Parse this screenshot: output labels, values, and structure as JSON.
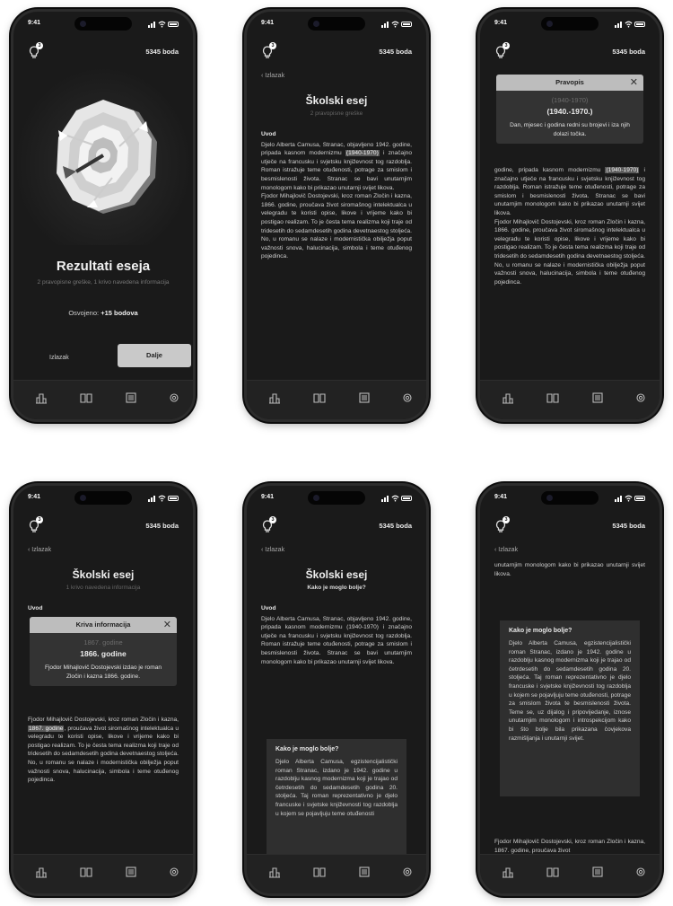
{
  "status": {
    "time": "9:41"
  },
  "header": {
    "points": "5345 boda",
    "hint_count": "3"
  },
  "nav": {
    "back": "Izlazak"
  },
  "tabs": [
    "stats",
    "book",
    "essay",
    "settings"
  ],
  "screen1": {
    "title": "Rezultati eseja",
    "subtitle": "2 pravopisne greške, 1 krivo navedena informacija",
    "earned_label": "Osvojeno:",
    "earned_value": "+15 bodova",
    "exit_label": "Izlazak",
    "next_label": "Dalje"
  },
  "screen2": {
    "title": "Školski esej",
    "subtitle": "2 pravopisne greške",
    "section": "Uvod",
    "p1_a": "Djelo Alberta Camusa, Stranac, objavljeno 1942. godine, pripada kasnom modernizmu ",
    "p1_hl": "(1940-1970)",
    "p1_b": " i značajno utječe na francusku i svjetsku književnost tog razdoblja. Roman istražuje teme otuđenosti, potrage za smislom i besmislenosti života. Stranac se bavi unutarnjim monologom kako bi prikazao unutarnji svijet likova.",
    "p2": "Fjodor Mihajlovič Dostojevski, kroz roman Zločin i kazna, 1866. godine, proučava život siromašnog intelektualca u velegradu te koristi opise, likove i vrijeme kako bi postigao realizam. To je česta tema realizma koji traje od tridesetih do sedamdesetih godina devetnaestog stoljeća. No, u romanu se nalaze i modernistička obilježja poput važnosti snova, halucinacija, simbola i teme otuđenog pojedinca."
  },
  "screen3": {
    "modal_title": "Pravopis",
    "old": "(1940-1970)",
    "new": "(1940.-1970.)",
    "note": "Dan, mjesec i godina redni su brojevi i iza njih dolazi točka.",
    "p1_a": "godine, pripada kasnom modernizmu ",
    "p1_hl": "(1940-1970)",
    "p1_b": " i značajno utječe na francusku i svjetsku književnost tog razdoblja. Roman istražuje teme otuđenosti, potrage za smislom i besmislenosti života. Stranac se bavi unutarnjim monologom kako bi prikazao unutarnji svijet likova.",
    "p2": "Fjodor Mihajlovič Dostojevski, kroz roman Zločin i kazna, 1866. godine, proučava život siromašnog intelektualca u velegradu te koristi opise, likove i vrijeme kako bi postigao realizam. To je česta tema realizma koji traje od tridesetih do sedamdesetih godina devetnaestog stoljeća. No, u romanu se nalaze i modernistička obilježja poput važnosti snova, halucinacija, simbola i teme otuđenog pojedinca."
  },
  "screen4": {
    "title": "Školski esej",
    "subtitle": "1 krivo navedena informacija",
    "section": "Uvod",
    "modal_title": "Kriva informacija",
    "old": "1867. godine",
    "new": "1866. godine",
    "note": "Fjodor Mihajlovič Dostojevski izdao je roman Zločin i kazna 1866. godine.",
    "p_a": "Fjodor Mihajlovič Dostojevski, kroz roman Zločin i kazna, ",
    "p_hl": "1867. godine",
    "p_b": ", proučava život siromašnog intelektualca u velegradu te koristi opise, likove i vrijeme kako bi postigao realizam. To je česta tema realizma koji traje od tridesetih do sedamdesetih godina devetnaestog stoljeća. No, u romanu se nalaze i modernistička obilježja poput važnosti snova, halucinacija, simbola i teme otuđenog pojedinca."
  },
  "screen5": {
    "title": "Školski esej",
    "subtitle": "Kako je moglo bolje?",
    "section": "Uvod",
    "p1": "Djelo Alberta Camusa, Stranac, objavljeno 1942. godine, pripada kasnom modernizmu (1940-1970) i značajno utječe na francusku i svjetsku književnost tog razdoblja. Roman istražuje teme otuđenosti, potrage za smislom i besmislenosti života. Stranac se bavi unutarnjim monologom kako bi prikazao unutarnji svijet likova.",
    "card_title": "Kako je moglo bolje?",
    "card_text": "Djelo Alberta Camusa, egzistencijalistički roman Stranac, izdano je 1942. godine u razdoblju kasnog modernizma koji je trajao od četrdesetih do sedamdesetih godina 20. stoljeća. Taj roman reprezentativno je djelo francuske i svjetske književnosti tog razdoblja u kojem se pojavljuju teme otuđenosti"
  },
  "screen6": {
    "top": "unutarnjim monologom kako bi prikazao unutarnji svijet likova.",
    "card_title": "Kako je moglo bolje?",
    "card_text": "Djelo Alberta Camusa, egzistencijalistički roman Stranac, izdano je 1942. godine u razdoblju kasnog modernizma koji je trajao od četrdesetih do sedamdesetih godina 20. stoljeća. Taj roman reprezentativno je djelo francuske i svjetske književnosti tog razdoblja u kojem se pojavljuju teme otuđenosti, potrage za smislom života te besmislenosti života. Teme se, uz dijalog i pripovijedanje, iznose unutarnjim monologom i introspekcijom kako bi što bolje bila prikazana čovjekova razmišljanja i unutarnji svijet.",
    "bottom": "Fjodor Mihajlovič Dostojevski, kroz roman Zločin i kazna, 1867. godine, proučava život"
  }
}
